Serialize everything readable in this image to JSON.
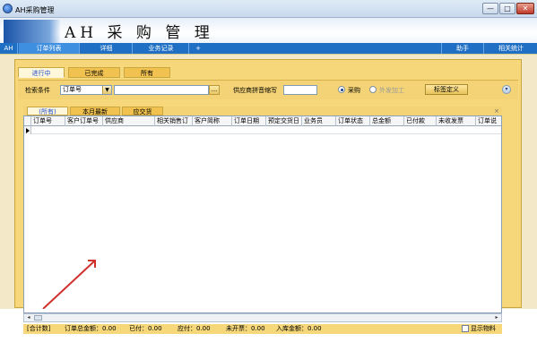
{
  "window": {
    "title": "AH采购管理",
    "min_label": "—",
    "max_label": "□",
    "close_label": "✕"
  },
  "banner": {
    "title": "AH 采 购 管 理"
  },
  "menubar": {
    "items": [
      "AH",
      "订单列表",
      "详细",
      "业务记录",
      "+"
    ],
    "right_items": [
      "助手",
      "相关统计"
    ]
  },
  "status_tabs": [
    "进行中",
    "已完成",
    "所有"
  ],
  "search": {
    "condition_label": "检索条件",
    "condition_value": "订单号",
    "input_value": "",
    "browse_label": "...",
    "supplier_label": "供应商拼音缩写",
    "supplier_value": "",
    "radio_purchase": "采购",
    "radio_outsource": "外发加工",
    "tag_button": "标签定义"
  },
  "grid_tabs": [
    "(所有)",
    "本月最新",
    "应交货"
  ],
  "columns": [
    "订单号",
    "客户订单号",
    "供应商",
    "相关销售订",
    "客户简称",
    "订单日期",
    "预定交货日",
    "业务员",
    "订单状态",
    "总金额",
    "已付款",
    "未收发票",
    "订单说"
  ],
  "footer": {
    "total_label": "[合计数]",
    "order_total": "订单总金额：0.00",
    "paid": "已付：0.00",
    "payable": "应付：0.00",
    "uninvoiced": "未开票：0.00",
    "stock_amount": "入库金额：0.00",
    "show_material": "显示物料"
  },
  "colors": {
    "menubar": "#1f6fc4",
    "panel": "#f6d77a",
    "annotation_arrow": "#d0312d"
  }
}
